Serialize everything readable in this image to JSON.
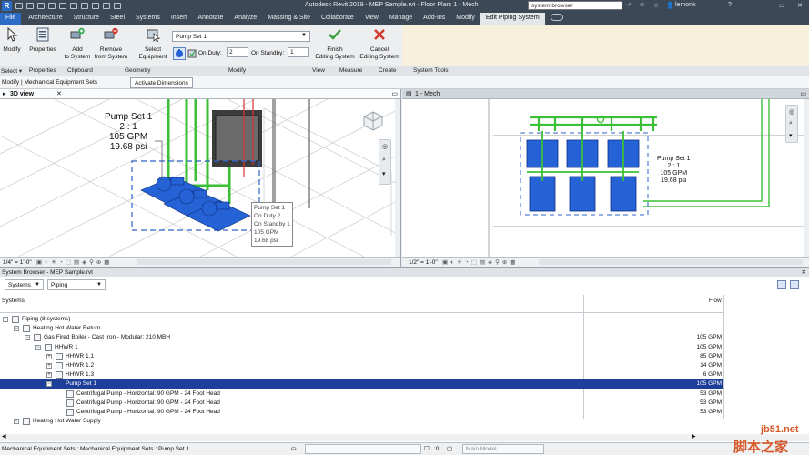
{
  "app": {
    "title": "Autodesk Revit 2019 - MEP Sample.rvt - Floor Plan: 1 - Mech",
    "search_placeholder": "system browser",
    "user": "lemonk"
  },
  "tabs": [
    {
      "label": "File"
    },
    {
      "label": "Architecture"
    },
    {
      "label": "Structure"
    },
    {
      "label": "Steel"
    },
    {
      "label": "Systems"
    },
    {
      "label": "Insert"
    },
    {
      "label": "Annotate"
    },
    {
      "label": "Analyze"
    },
    {
      "label": "Massing & Site"
    },
    {
      "label": "Collaborate"
    },
    {
      "label": "View"
    },
    {
      "label": "Manage"
    },
    {
      "label": "Add-Ins"
    },
    {
      "label": "Modify"
    },
    {
      "label": "Edit Piping System"
    }
  ],
  "ribbon": {
    "modify": "Modify",
    "properties": "Properties",
    "add_to_system": [
      "Add",
      "to System"
    ],
    "remove_from_system": [
      "Remove",
      "from System"
    ],
    "select_equipment": [
      "Select",
      "Equipment"
    ],
    "system_name": "Pump Set 1",
    "on_duty_label": "On Duty:",
    "on_duty_value": "2",
    "on_standby_label": "On Standby:",
    "on_standby_value": "1",
    "finish": [
      "Finish",
      "Editing System"
    ],
    "cancel": [
      "Cancel",
      "Editing System"
    ],
    "panels": {
      "select": "Select ▾",
      "properties": "Properties",
      "clipboard": "Clipboard",
      "geometry": "Geometry",
      "modify": "Modify",
      "view": "View",
      "measure": "Measure",
      "create": "Create",
      "system_tools": "System Tools"
    }
  },
  "options_bar": {
    "context": "Modify | Mechanical Equipment Sets",
    "button": "Activate Dimensions"
  },
  "view_left": {
    "tab": "3D view",
    "label": [
      "Pump Set 1",
      "2 : 1",
      "105 GPM",
      "19.68 psi"
    ],
    "tooltip": [
      "Pump Set 1",
      "On Duty 2",
      "On Standby 1",
      "105 GPM",
      "19.68 psi"
    ],
    "scale": "1/4\" = 1'-0\""
  },
  "view_right": {
    "tab": "1 - Mech",
    "label": [
      "Pump Set 1",
      "2 : 1",
      "105 GPM",
      "19.68 psi"
    ],
    "scale": "1/2\" = 1'-0\""
  },
  "system_browser": {
    "title": "System Browser - MEP Sample.rvt",
    "filter_systems": "Systems",
    "filter_discipline": "Piping",
    "col_systems": "Systems",
    "col_flow": "Flow",
    "rows": [
      {
        "name": "Piping (8 systems)",
        "flow": "",
        "indent": 0,
        "toggle": "−"
      },
      {
        "name": "Heating Hot Water Return",
        "flow": "",
        "indent": 1,
        "toggle": "−"
      },
      {
        "name": "Gas Fired Boiler - Cast Iron - Modular: 210 MBH",
        "flow": "105 GPM",
        "indent": 2,
        "toggle": "−"
      },
      {
        "name": "HHWR 1",
        "flow": "105 GPM",
        "indent": 3,
        "toggle": "−"
      },
      {
        "name": "HHWR 1.1",
        "flow": "85 GPM",
        "indent": 4,
        "toggle": "+"
      },
      {
        "name": "HHWR 1.2",
        "flow": "14 GPM",
        "indent": 4,
        "toggle": "+"
      },
      {
        "name": "HHWR 1.3",
        "flow": "6 GPM",
        "indent": 4,
        "toggle": "+"
      },
      {
        "name": "Pump Set 1",
        "flow": "105 GPM",
        "indent": 4,
        "toggle": "−"
      },
      {
        "name": "Centrifugal Pump - Horizontal: 90 GPM - 24 Foot Head",
        "flow": "53 GPM",
        "indent": 5,
        "toggle": ""
      },
      {
        "name": "Centrifugal Pump - Horizontal: 90 GPM - 24 Foot Head",
        "flow": "53 GPM",
        "indent": 5,
        "toggle": ""
      },
      {
        "name": "Centrifugal Pump - Horizontal: 90 GPM - 24 Foot Head",
        "flow": "53 GPM",
        "indent": 5,
        "toggle": ""
      },
      {
        "name": "Heating Hot Water Supply",
        "flow": "",
        "indent": 1,
        "toggle": "+"
      }
    ],
    "selected_row": 7
  },
  "status": {
    "text": "Mechanical Equipment Sets : Mechanical Equipment Sets : Pump Set 1",
    "model": "Main Model",
    "zero": ":0"
  },
  "watermark": [
    "jb51.net",
    "脚本之家"
  ],
  "colors": {
    "ribbon_dark": "#3d4856",
    "file_tab": "#2c6cc4",
    "selection": "#1d3e99",
    "pipe_green": "#3bbf36",
    "equipment_blue": "#2462d6"
  }
}
